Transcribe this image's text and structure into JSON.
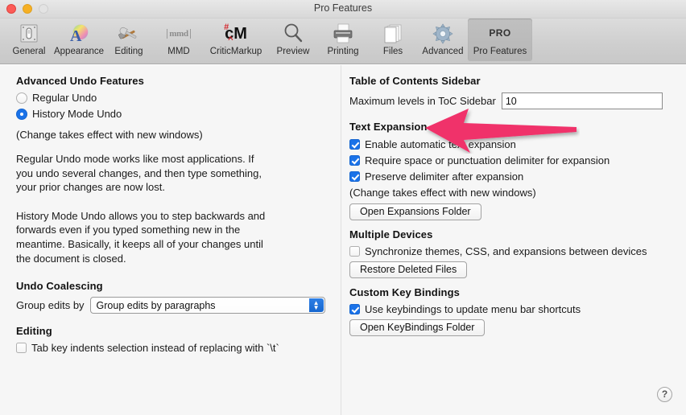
{
  "window": {
    "title": "Pro Features",
    "traffic_lights": [
      "close",
      "minimize",
      "zoom"
    ]
  },
  "toolbar": {
    "items": [
      {
        "label": "General",
        "icon": "switch-icon",
        "selected": false
      },
      {
        "label": "Appearance",
        "icon": "palette-a-icon",
        "selected": false
      },
      {
        "label": "Editing",
        "icon": "hammer-wrench-icon",
        "selected": false
      },
      {
        "label": "MMD",
        "icon": "mmd-icon",
        "selected": false
      },
      {
        "label": "CriticMarkup",
        "icon": "critic-markup-icon",
        "selected": false
      },
      {
        "label": "Preview",
        "icon": "magnifier-icon",
        "selected": false
      },
      {
        "label": "Printing",
        "icon": "printer-icon",
        "selected": false
      },
      {
        "label": "Files",
        "icon": "documents-icon",
        "selected": false
      },
      {
        "label": "Advanced",
        "icon": "gear-icon",
        "selected": false
      },
      {
        "label": "Pro Features",
        "icon": "pro-badge-icon",
        "badge": "PRO",
        "selected": true
      }
    ]
  },
  "left_column": {
    "undo_section_title": "Advanced Undo Features",
    "radio_regular": "Regular Undo",
    "radio_history": "History Mode Undo",
    "radio_selected": "history",
    "change_note": "(Change takes effect with new windows)",
    "paragraph_regular": "Regular Undo mode works like most applications. If you undo several changes, and then type something, your prior changes are now lost.",
    "paragraph_history": "History Mode Undo allows you to step backwards and forwards even if you typed something new in the meantime. Basically, it keeps all of your changes until the document is closed.",
    "coalescing_title": "Undo Coalescing",
    "group_edits_label": "Group edits by",
    "group_edits_value": "Group edits by paragraphs",
    "editing_title": "Editing",
    "tab_key_label": "Tab key indents selection instead of replacing with `\\t`",
    "tab_key_checked": false
  },
  "right_column": {
    "toc_title": "Table of Contents Sidebar",
    "toc_label": "Maximum levels in ToC Sidebar",
    "toc_value": "10",
    "text_expansion_title": "Text Expansion",
    "expansion_options": [
      {
        "label": "Enable automatic text expansion",
        "checked": true
      },
      {
        "label": "Require space or punctuation delimiter for expansion",
        "checked": true
      },
      {
        "label": "Preserve delimiter after expansion",
        "checked": true
      }
    ],
    "expansion_note": "(Change takes effect with new windows)",
    "open_expansions_button": "Open Expansions Folder",
    "devices_title": "Multiple Devices",
    "sync_label": "Synchronize themes, CSS, and expansions between devices",
    "sync_checked": false,
    "restore_button": "Restore Deleted Files",
    "keybindings_title": "Custom Key Bindings",
    "keybindings_label": "Use keybindings to update menu bar shortcuts",
    "keybindings_checked": true,
    "open_keybindings_button": "Open KeyBindings Folder"
  },
  "help_button": {
    "label": "?"
  },
  "annotation": {
    "type": "arrow",
    "direction": "left",
    "points_at": "Text Expansion",
    "color": "#F0306B"
  },
  "colors": {
    "accent": "#1a72e8",
    "annotation": "#F0306B",
    "window_bg": "#f6f6f6",
    "toolbar_bg": "#cfcfcf"
  }
}
